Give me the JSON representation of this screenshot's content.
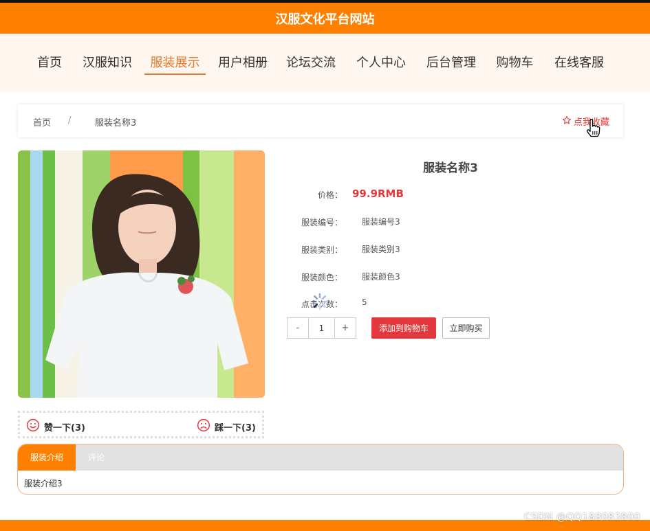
{
  "site": {
    "title": "汉服文化平台网站"
  },
  "nav": {
    "items": [
      {
        "label": "首页"
      },
      {
        "label": "汉服知识"
      },
      {
        "label": "服装展示"
      },
      {
        "label": "用户相册"
      },
      {
        "label": "论坛交流"
      },
      {
        "label": "个人中心"
      },
      {
        "label": "后台管理"
      },
      {
        "label": "购物车"
      },
      {
        "label": "在线客服"
      }
    ],
    "active_label": "服装展示"
  },
  "breadcrumb": {
    "home": "首页",
    "separator": "/",
    "current": "服装名称3",
    "favorite_label": "点我收藏",
    "favorite_icon": "star-outline-icon"
  },
  "product": {
    "name": "服装名称3",
    "price_label": "价格：",
    "price": "99.9RMB",
    "fields": [
      {
        "label": "服装编号：",
        "value": "服装编号3"
      },
      {
        "label": "服装类别：",
        "value": "服装类别3"
      },
      {
        "label": "服装颜色：",
        "value": "服装颜色3"
      },
      {
        "label": "点击次数：",
        "value": "5"
      }
    ],
    "quantity": {
      "minus": "-",
      "value": "1",
      "plus": "+"
    },
    "add_to_cart_label": "添加到购物车",
    "buy_now_label": "立即购买",
    "image_alt": "product-photo"
  },
  "votes": {
    "like_label": "赞一下(3)",
    "dislike_label": "踩一下(3)",
    "like_icon": "smile-icon",
    "dislike_icon": "frown-icon"
  },
  "tabs": {
    "items": [
      {
        "label": "服装介绍"
      },
      {
        "label": "评论"
      }
    ],
    "active_index": 0,
    "content": "服装介绍3"
  },
  "watermark": "CSDN @QQ188083800",
  "colors": {
    "brand_orange": "#ff7f00",
    "active_nav": "#e07a2a",
    "price_red": "#e4393c",
    "nav_bg": "#fff6ef"
  }
}
